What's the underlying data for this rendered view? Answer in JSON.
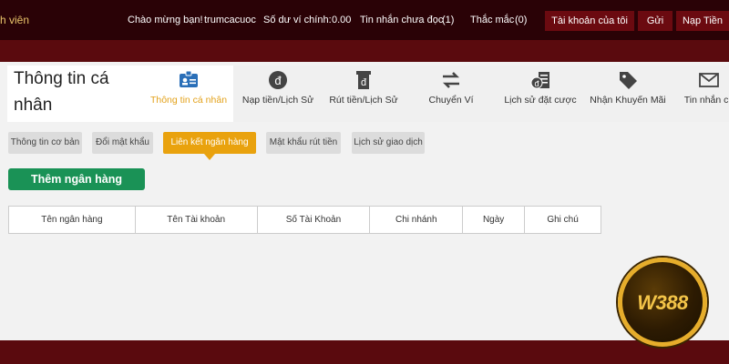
{
  "topbar": {
    "member_fragment": "h viên",
    "greeting": "Chào mừng bạn!",
    "username": "trumcacuoc",
    "balance_label": "Số dư ví chính:",
    "balance_value": "0.00",
    "unread_label": "Tin nhắn chưa đọc",
    "unread_count": "(1)",
    "faq_label": "Thắc mắc",
    "faq_count": "(0)",
    "my_account": "Tài khoản của tôi",
    "send": "Gửi",
    "deposit": "Nạp Tiền"
  },
  "page_title": "Thông tin cá nhân",
  "tabs": [
    {
      "label": "Thông tin cá nhân",
      "icon": "id-card-icon",
      "active": true
    },
    {
      "label": "Nạp tiền/Lịch Sử",
      "icon": "coin-icon",
      "active": false
    },
    {
      "label": "Rút tiền/Lịch Sử",
      "icon": "withdraw-card-icon",
      "active": false
    },
    {
      "label": "Chuyển Ví",
      "icon": "transfer-arrows-icon",
      "active": false
    },
    {
      "label": "Lịch sử đặt cược",
      "icon": "bet-history-icon",
      "active": false
    },
    {
      "label": "Nhận Khuyến Mãi",
      "icon": "tag-icon",
      "active": false
    },
    {
      "label": "Tin nhắn củ",
      "icon": "envelope-icon",
      "active": false
    }
  ],
  "subtabs": [
    {
      "label": "Thông tin cơ bản",
      "active": false
    },
    {
      "label": "Đổi mật khẩu",
      "active": false
    },
    {
      "label": "Liên kết ngân hàng",
      "active": true
    },
    {
      "label": "Mật khẩu rút tiền",
      "active": false
    },
    {
      "label": "Lịch sử giao dịch",
      "active": false
    }
  ],
  "add_bank_button": "Thêm ngân hàng",
  "table_headers": [
    "Tên ngân hàng",
    "Tên Tài khoản",
    "Số Tài Khoản",
    "Chi nhánh",
    "Ngày",
    "Ghi chú"
  ],
  "logo_text": "W388",
  "colors": {
    "accent": "#e9a20e",
    "green": "#1a9256",
    "maroon": "#5a0a0e",
    "dark": "#2a0206"
  }
}
